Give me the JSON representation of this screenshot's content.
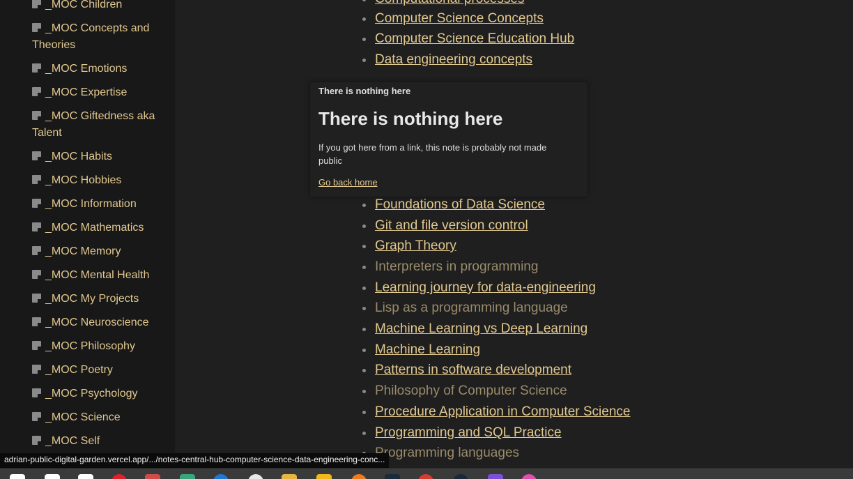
{
  "sidebar": {
    "items": [
      {
        "label": "_MOC Children"
      },
      {
        "label": "_MOC Concepts and Theories"
      },
      {
        "label": "_MOC Emotions"
      },
      {
        "label": "_MOC Expertise"
      },
      {
        "label": "_MOC Giftedness aka Talent"
      },
      {
        "label": "_MOC Habits"
      },
      {
        "label": "_MOC Hobbies"
      },
      {
        "label": "_MOC Information"
      },
      {
        "label": "_MOC Mathematics"
      },
      {
        "label": "_MOC Memory"
      },
      {
        "label": "_MOC Mental Health"
      },
      {
        "label": "_MOC My Projects"
      },
      {
        "label": "_MOC Neuroscience"
      },
      {
        "label": "_MOC Philosophy"
      },
      {
        "label": "_MOC Poetry"
      },
      {
        "label": "_MOC Psychology"
      },
      {
        "label": "_MOC Science"
      },
      {
        "label": "_MOC Self"
      }
    ]
  },
  "main": {
    "links": [
      {
        "label": "Computational processes",
        "public": true
      },
      {
        "label": "Computer Science Concepts",
        "public": true
      },
      {
        "label": "Computer Science Education Hub",
        "public": true
      },
      {
        "label": "Data engineering concepts",
        "public": true
      },
      {
        "label": "Foundations of Data Science",
        "public": true
      },
      {
        "label": "Git and file version control",
        "public": true
      },
      {
        "label": "Graph Theory",
        "public": true
      },
      {
        "label": "Interpreters in programming",
        "public": false
      },
      {
        "label": "Learning journey for data-engineering",
        "public": true
      },
      {
        "label": "Lisp as a programming language",
        "public": false
      },
      {
        "label": "Machine Learning vs Deep Learning",
        "public": true
      },
      {
        "label": "Machine Learning",
        "public": true
      },
      {
        "label": "Patterns in software development",
        "public": true
      },
      {
        "label": "Philosophy of Computer Science",
        "public": false
      },
      {
        "label": "Procedure Application in Computer Science",
        "public": true
      },
      {
        "label": "Programming and SQL Practice",
        "public": true
      },
      {
        "label": "Programming languages",
        "public": false
      }
    ]
  },
  "popover": {
    "small_title": "There is nothing here",
    "title": "There is nothing here",
    "description": "If you got here from a link, this note is probably not made public",
    "home_link": "Go back home"
  },
  "status_bar": {
    "url": "adrian-public-digital-garden.vercel.app/.../notes-central-hub-computer-science-data-engineering-conc..."
  },
  "colors": {
    "link": "#e2c88f",
    "private_link": "#9a8b6b",
    "background": "#1f1f1f",
    "sidebar": "#181818"
  },
  "taskbar": {
    "icons": [
      {
        "name": "start-icon",
        "color": "#ffffff"
      },
      {
        "name": "search-icon",
        "color": "#ffffff"
      },
      {
        "name": "task-view-icon",
        "color": "#ffffff"
      },
      {
        "name": "opera-icon",
        "color": "#e0202a"
      },
      {
        "name": "app-icon",
        "color": "#d14b4b"
      },
      {
        "name": "chat-icon",
        "color": "#3aa57a"
      },
      {
        "name": "edge-icon",
        "color": "#1e78d6"
      },
      {
        "name": "github-icon",
        "color": "#e8e8e8"
      },
      {
        "name": "folder-icon",
        "color": "#e8b340"
      },
      {
        "name": "notes-icon",
        "color": "#f1b81c"
      },
      {
        "name": "firefox-icon",
        "color": "#f07a20"
      },
      {
        "name": "terminal-icon",
        "color": "#1b2b3a"
      },
      {
        "name": "chrome-icon",
        "color": "#d83c30"
      },
      {
        "name": "steam-icon",
        "color": "#1b2838"
      },
      {
        "name": "obsidian-icon",
        "color": "#7b4fd6"
      },
      {
        "name": "app2-icon",
        "color": "#e04fa8"
      }
    ]
  }
}
